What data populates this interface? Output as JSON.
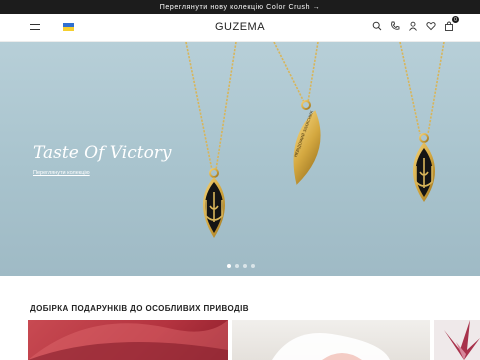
{
  "announcement": {
    "text": "Переглянути нову колекцію Color Crush →"
  },
  "header": {
    "logo": "GUZEMA",
    "cart_count": "0",
    "icons": [
      "menu-icon",
      "ukraine-flag-icon",
      "search-icon",
      "phone-icon",
      "user-icon",
      "heart-icon",
      "bag-icon"
    ]
  },
  "hero": {
    "title": "Taste Of Victory",
    "link": "Переглянути колекцію",
    "pendant_text": "НЕВІДОМИЙ ЗАХИСНИК",
    "slides_total": 4,
    "active_slide": 1
  },
  "gifts": {
    "title": "ДОБІРКА ПОДАРУНКІВ ДО ОСОБЛИВИХ ПРИВОДІВ"
  },
  "colors": {
    "hero_bg": "#a8c3cd",
    "gold": "#d4a840",
    "announce_bg": "#1c1c1c"
  }
}
